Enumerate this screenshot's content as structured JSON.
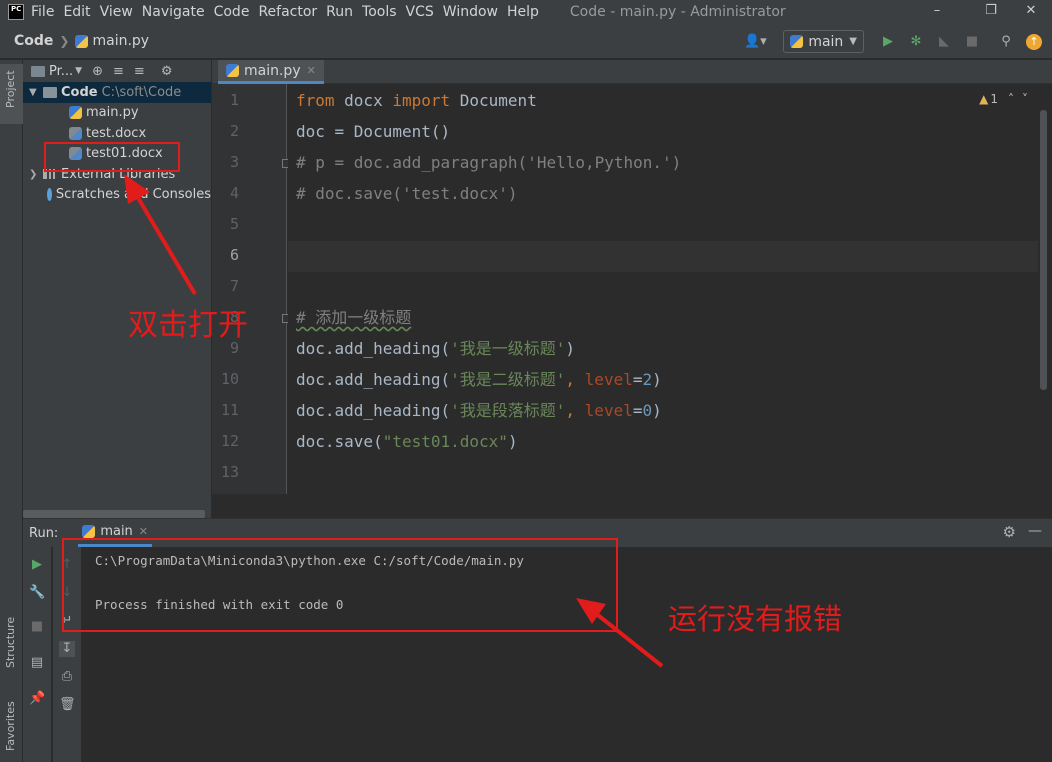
{
  "menu": {
    "items": [
      "File",
      "Edit",
      "View",
      "Navigate",
      "Code",
      "Refactor",
      "Run",
      "Tools",
      "VCS",
      "Window",
      "Help"
    ],
    "window_title": "Code - main.py - Administrator"
  },
  "nav": {
    "project": "Code",
    "file": "main.py",
    "run_config": "main"
  },
  "left_strip": {
    "project_tab": "Project",
    "structure_tab": "Structure",
    "favorites_tab": "Favorites"
  },
  "project_panel": {
    "header_label": "Pr...",
    "root_name": "Code",
    "root_path": "C:\\soft\\Code",
    "files": [
      "main.py",
      "test.docx",
      "test01.docx"
    ],
    "external_libraries": "External Libraries",
    "scratches": "Scratches and Consoles"
  },
  "editor": {
    "tab_label": "main.py",
    "inspection_count": "1",
    "current_line": 6,
    "line_numbers": [
      "1",
      "2",
      "3",
      "4",
      "5",
      "6",
      "7",
      "8",
      "9",
      "10",
      "11",
      "12",
      "13"
    ]
  },
  "code": {
    "l1_kw1": "from",
    "l1_mod": " docx ",
    "l1_kw2": "import",
    "l1_name": " Document",
    "l2": "doc = Document()",
    "l3": "# p = doc.add_paragraph('Hello,Python.')",
    "l4": "# doc.save('test.docx')",
    "l8": "# 添加一级标题",
    "l9_call": "doc.add_heading(",
    "l9_str": "'我是一级标题'",
    "l9_end": ")",
    "l10_call": "doc.add_heading(",
    "l10_str": "'我是二级标题'",
    "l10_comma": ", ",
    "l10_param": "level",
    "l10_eq": "=",
    "l10_num": "2",
    "l10_end": ")",
    "l11_call": "doc.add_heading(",
    "l11_str": "'我是段落标题'",
    "l11_comma": ", ",
    "l11_param": "level",
    "l11_eq": "=",
    "l11_num": "0",
    "l11_end": ")",
    "l12_call": "doc.save(",
    "l12_str": "\"test01.docx\"",
    "l12_end": ")"
  },
  "run_panel": {
    "label": "Run:",
    "tab_label": "main",
    "console_lines": [
      "C:\\ProgramData\\Miniconda3\\python.exe C:/soft/Code/main.py",
      "",
      "Process finished with exit code 0"
    ]
  },
  "annotations": {
    "double_click_open": "双击打开",
    "run_no_error": "运行没有报错"
  },
  "colors": {
    "annotation_red": "#e21b1b",
    "keyword": "#cc7832",
    "string": "#6a8759",
    "comment": "#808080",
    "number": "#6897bb",
    "accent": "#4a88c7"
  }
}
